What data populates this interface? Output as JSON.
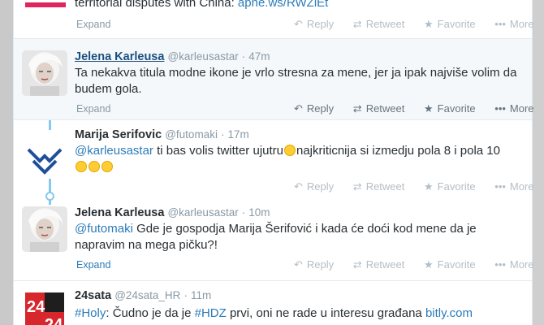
{
  "actions": {
    "reply": "Reply",
    "retweet": "Retweet",
    "favorite": "Favorite",
    "more": "More",
    "expand": "Expand"
  },
  "tweet_top": {
    "text_before": "territorial disputes with China: ",
    "link": "apne.ws/RWZiEt"
  },
  "tweet1": {
    "name": "Jelena Karleusa",
    "handle": "@karleusastar",
    "time": "47m",
    "text": "Ta nekakva titula modne ikone je vrlo stresna za mene, jer ja ipak najviše volim da budem gola."
  },
  "tweet2": {
    "name": "Marija Serifovic",
    "handle": "@futomaki",
    "time": "17m",
    "mention": "@karleusastar",
    "text": " ti bas volis twitter ujutru",
    "text2": "najkriticnija si izmedju pola 8 i pola 10"
  },
  "tweet3": {
    "name": "Jelena Karleusa",
    "handle": "@karleusastar",
    "time": "10m",
    "mention": "@futomaki",
    "text": " Gde je gospodja Marija Šerifović i kada će doći kod mene da je napravim na mega pičku?!"
  },
  "tweet4": {
    "name": "24sata",
    "handle": "@24sata_HR",
    "time": "11m",
    "hashtag1": "#Holy",
    "text_mid": ": Čudno je da je ",
    "hashtag2": "#HDZ",
    "text_end": " prvi, oni ne rade u interesu građana ",
    "link": "bitly.com",
    "avatar_text": "24"
  },
  "colors": {
    "link": "#2b7bb9",
    "conversation_line": "#86c9ee",
    "highlight_bg": "#f5f8fa"
  }
}
